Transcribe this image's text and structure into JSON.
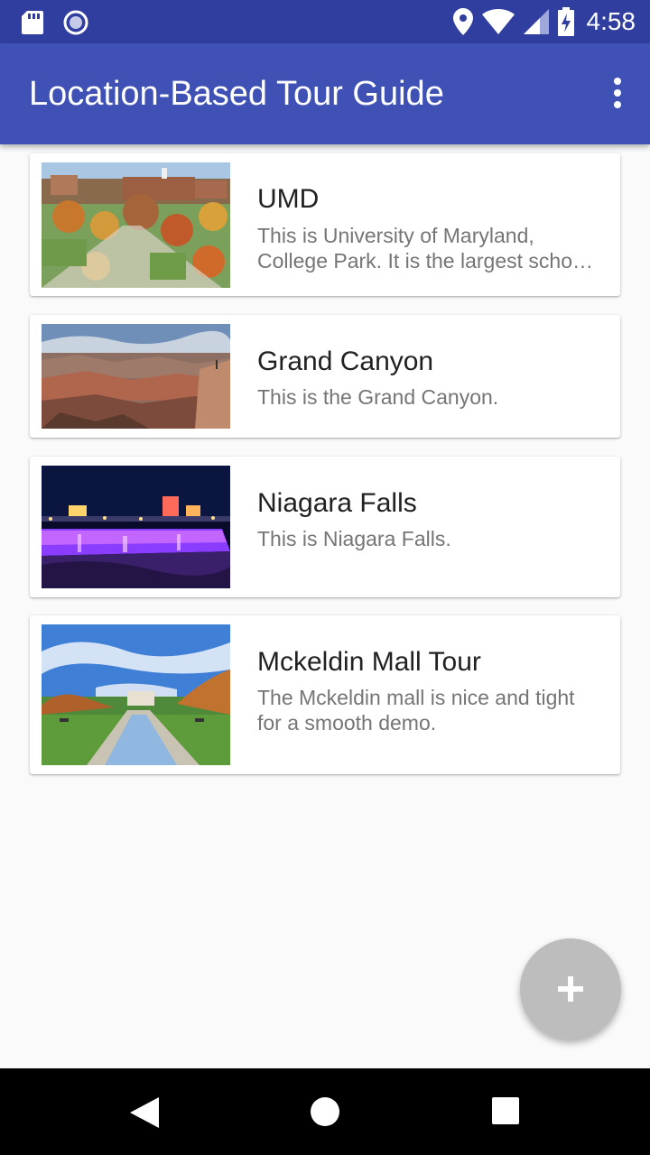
{
  "status_bar": {
    "time": "4:58",
    "icons": [
      "sd-card-icon",
      "circle-icon",
      "location-icon",
      "wifi-icon",
      "signal-icon",
      "battery-charging-icon"
    ]
  },
  "app_bar": {
    "title": "Location-Based Tour Guide",
    "overflow_icon": "more-vert-icon"
  },
  "tours": [
    {
      "name": "UMD",
      "description": "This is University of Maryland, College Park. It is the largest school in Maryland.",
      "image": "umd-campus-photo"
    },
    {
      "name": "Grand Canyon",
      "description": "This is the Grand Canyon.",
      "image": "grand-canyon-photo"
    },
    {
      "name": "Niagara Falls",
      "description": "This is Niagara Falls.",
      "image": "niagara-falls-night-photo"
    },
    {
      "name": "Mckeldin Mall Tour",
      "description": "The Mckeldin mall is nice and tight for a smooth demo.",
      "image": "mckeldin-mall-photo"
    }
  ],
  "fab": {
    "icon": "add-icon"
  },
  "nav_bar": {
    "icons": [
      "back-icon",
      "home-icon",
      "recents-icon"
    ]
  },
  "colors": {
    "primary": "#3f51b5",
    "primary_dark": "#303f9f",
    "fab": "#bdbdbd"
  }
}
